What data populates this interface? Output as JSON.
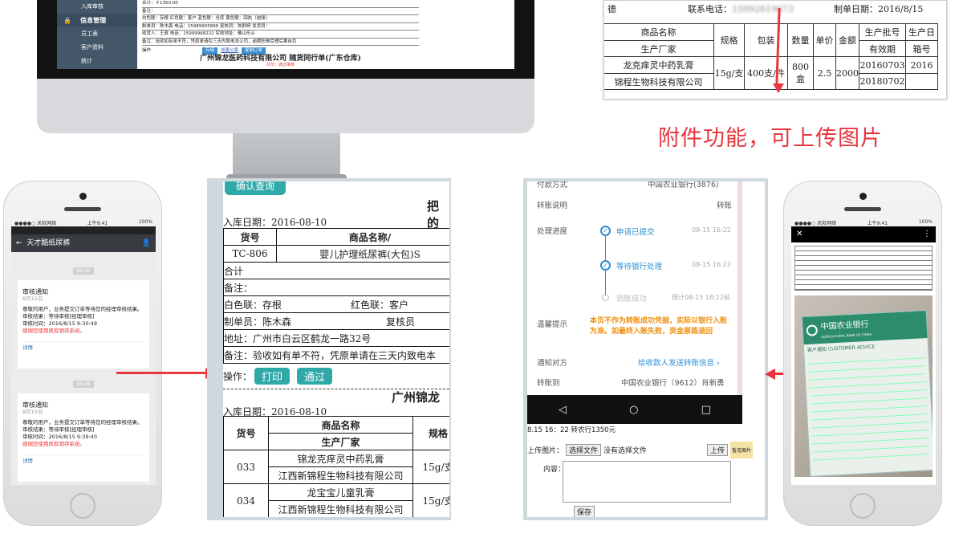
{
  "imac": {
    "sidebar": {
      "top_item": "入库审核",
      "section": "信息管理",
      "items": [
        "员工表",
        "客户资料",
        "统计"
      ]
    },
    "doc_lines": [
      "合计：￥1350.00",
      "备注：",
      "白色联：存根 红色联：客户 蓝色联：仓库 黄色联：回执（结账）",
      "制单员：陈木森 电话：15989905896 复核员：陈舒婷 发货员：",
      "收货人：王政 电话：15999968222 实收地址：佛山乐从",
      "备注：验收如有单不符，凭原单请在三天内致电本公司，逾期恕难受理后果自负"
    ],
    "ops": {
      "label": "操作",
      "save": "存储",
      "stamp": "加盖公章",
      "copy": "复制订单"
    },
    "company_title": "广州锦龙医药科技有限公司 随货同行单(广东仓库)",
    "company_sub": "打印：通过审核"
  },
  "top_right": {
    "phone_label": "联系电话：",
    "phone_value": "15992819673",
    "date_label": "制单日期：",
    "date_value": "2016/8/15",
    "left_label": "德",
    "headers": {
      "name": "商品名称",
      "maker": "生产厂家",
      "spec": "规格",
      "pack": "包装",
      "qty": "数量",
      "price": "单价",
      "amount": "金额",
      "batch": "生产批号",
      "expiry": "有效期",
      "date2": "生产日",
      "box": "箱号"
    },
    "row": {
      "name": "龙克痒灵中药乳膏",
      "maker": "锦程生物科技有限公司",
      "spec": "15g/支",
      "pack": "400支/件",
      "qty": "800盒",
      "price": "2.5",
      "amount": "2000",
      "batch": "20160703",
      "expiry": "20180702",
      "date2": "2016"
    }
  },
  "attachment_caption": "附件功能，可上传图片",
  "phone_left": {
    "status": {
      "carrier": "●●●●○ 凤软网络",
      "time": "上午9:41",
      "battery": "100%"
    },
    "title": "天才酷纸尿裤",
    "messages": [
      {
        "time": "09:30",
        "title": "审核通知",
        "date": "8月15日",
        "line1": "尊敬的用户，业务提交订单等待您的经理审核结果。",
        "line2": "审核结果：等待审核[经理审核]",
        "line3": "审核时间：2016/8/15 9:30:49",
        "warn": "感谢您使用凤软销存系统。",
        "detail": "详情"
      },
      {
        "time": "09:39",
        "title": "审核通知",
        "date": "8月15日",
        "line1": "尊敬的用户，业务提交订单等待您的经理审核结果。",
        "line2": "审核结果：等待审核[经理审核]",
        "line3": "审核时间：2016/8/15 9:39:40",
        "warn": "感谢您使用凤软销存系统。",
        "detail": "详情"
      }
    ]
  },
  "middle_doc": {
    "query_btn": "确认查询",
    "heading_part": "把的",
    "date_line": "入库日期：2016-08-10",
    "h_no": "货号",
    "h_name": "商品名称/",
    "row_no": "TC-806",
    "row_name": "婴儿护理纸尿裤(大包)S",
    "total": "合计",
    "remark": "备注：",
    "white": "白色联：存根",
    "red": "红色联：客户",
    "maker": "制单员：陈木森",
    "review": "复核员",
    "address": "地址：广州市白云区鹤龙一路32号",
    "remark2": "备注：验收如有单不符，凭原单请在三天内致电本",
    "ops_label": "操作：",
    "print_btn": "打印",
    "pass_btn": "通过",
    "company_part": "广州锦龙",
    "date_line2": "入库日期：2016-08-10",
    "h2_name": "商品名称",
    "h2_maker": "生产厂家",
    "h2_spec": "规格",
    "rows": [
      {
        "no": "033",
        "name": "锦龙克痒灵中药乳膏",
        "maker": "江西新锦程生物科技有限公司",
        "spec": "15g/支"
      },
      {
        "no": "034",
        "name": "龙宝宝儿童乳膏",
        "maker": "江西新锦程生物科技有限公司",
        "spec": "15g/支"
      }
    ]
  },
  "transfer": {
    "method_label": "付款方式",
    "method_value": "中国农业银行(3876)",
    "desc_label": "转账说明",
    "desc_value": "转账",
    "progress_label": "处理进度",
    "steps": [
      {
        "text": "申请已提交",
        "time": "08-15 16:22"
      },
      {
        "text": "等待银行处理",
        "time": "08-15 16:22"
      },
      {
        "text": "到账成功",
        "time": "预计08-15 18:22前"
      }
    ],
    "tip_label": "温馨提示",
    "tip_text": "本页不作为转账成功凭据，实际以银行入账为准。如最终入账失败，资金原路退回",
    "notify_label": "通知对方",
    "notify_value": "给收款人发送转账信息",
    "account_label": "转账到",
    "account_value": "中国农业银行（9612）肖新勇",
    "note_line": "8.15 16：22 转农行1350元",
    "upload_label": "上传图片：",
    "choose_btn": "选择文件",
    "no_file": "没有选择文件",
    "upload_btn": "上传",
    "view_img": "暂无图片",
    "content_label": "内容：",
    "save_btn": "保存"
  },
  "phone_right": {
    "status": {
      "carrier": "●●●●○ 凤软网络",
      "time": "上午9:41",
      "battery": "100%"
    },
    "close": "✕",
    "bank_name": "中国农业银行",
    "bank_en": "AGRICULTURAL BANK OF CHINA",
    "advice": "客户通知 CUSTOMER ADVICE"
  }
}
